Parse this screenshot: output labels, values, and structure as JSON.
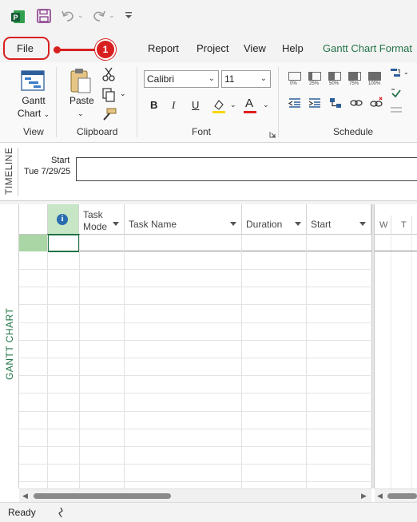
{
  "qat": {
    "app_icon": "project-app-icon",
    "save_icon": "save-icon",
    "undo_icon": "undo-icon",
    "redo_icon": "redo-icon",
    "customize_icon": "customize-qat-icon"
  },
  "tabs": {
    "file": "File",
    "report": "Report",
    "project": "Project",
    "view": "View",
    "help": "Help",
    "gantt_format": "Gantt Chart Format"
  },
  "callout": {
    "number": "1",
    "color": "#d81f1f"
  },
  "ribbon": {
    "view_group": {
      "button_line1": "Gantt",
      "button_line2": "Chart",
      "label": "View"
    },
    "clipboard_group": {
      "paste": "Paste",
      "label": "Clipboard"
    },
    "font_group": {
      "font_name": "Calibri",
      "font_size": "11",
      "bold": "B",
      "italic": "I",
      "underline": "U",
      "font_color_glyph": "A",
      "label": "Font",
      "highlight_color": "#f5d800",
      "font_color": "#e02020"
    },
    "schedule_group": {
      "percent_labels": [
        "0%",
        "25%",
        "50%",
        "75%",
        "100%"
      ],
      "label": "Schedule"
    }
  },
  "timeline": {
    "side_label": "TIMELINE",
    "start_label": "Start",
    "start_date": "Tue 7/29/25"
  },
  "gantt": {
    "side_label": "GANTT CHART",
    "columns": {
      "info": "i",
      "task_mode_line1": "Task",
      "task_mode_line2": "Mode",
      "task_name": "Task Name",
      "duration": "Duration",
      "start": "Start"
    },
    "timescale": [
      "W",
      "T"
    ],
    "accent": "#217346"
  },
  "status": {
    "ready": "Ready"
  }
}
